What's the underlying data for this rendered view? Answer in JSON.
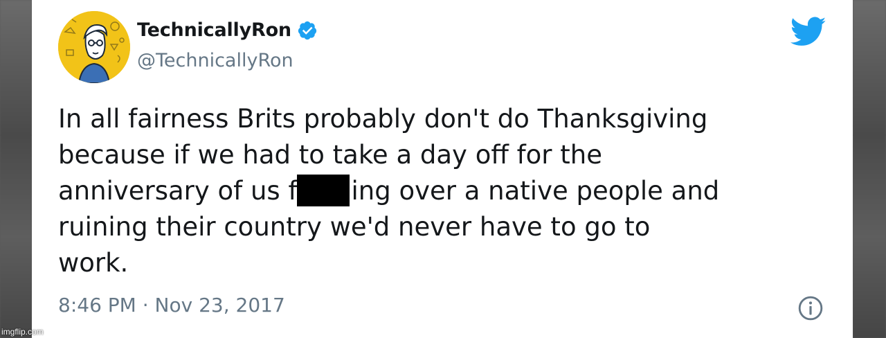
{
  "tweet": {
    "display_name": "TechnicallyRon",
    "handle": "@TechnicallyRon",
    "verified": true,
    "text_lines": [
      "In all fairness Brits probably don't do Thanksgiving",
      "because if we had to take a day off for the",
      [
        "anniversary of us f",
        "ing over a native people and"
      ],
      "ruining their country we'd never have to go to",
      "work."
    ],
    "timestamp": "8:46 PM · Nov 23, 2017"
  },
  "icons": {
    "brand": "twitter-bird-icon",
    "verified": "verified-badge-icon",
    "info": "info-icon"
  },
  "colors": {
    "twitter_blue": "#1da1f2",
    "text_primary": "#14171a",
    "text_secondary": "#657786",
    "avatar_background": "#f2c318"
  },
  "watermark": "imgflip.com"
}
